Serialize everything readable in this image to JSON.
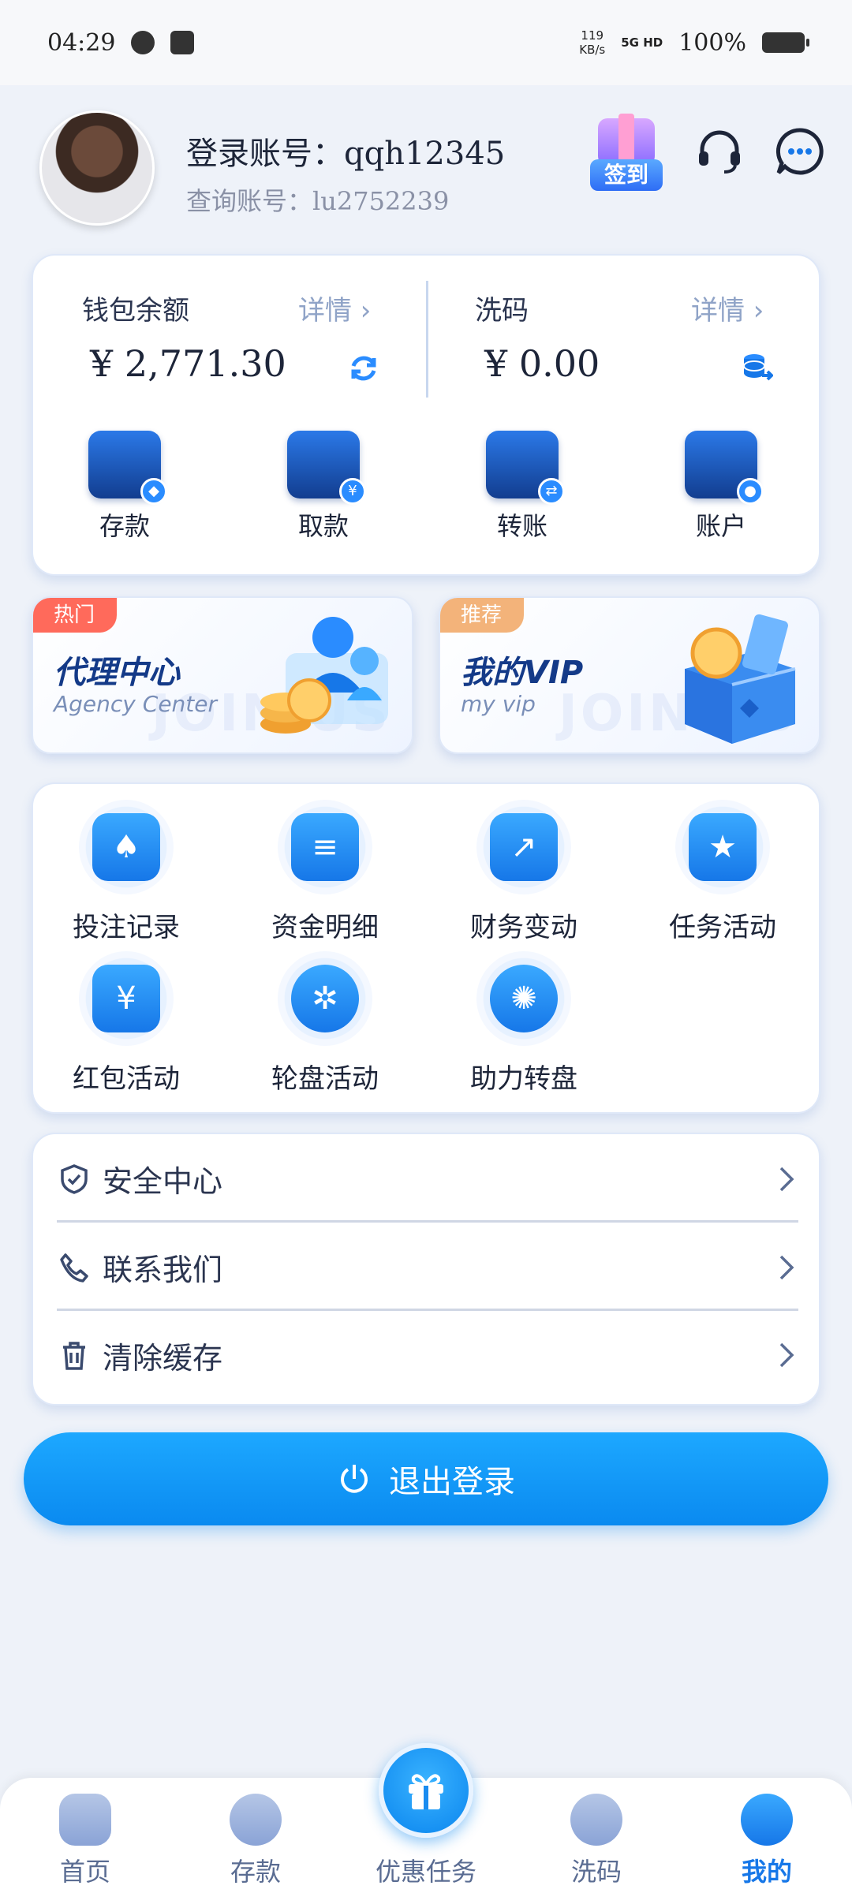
{
  "status_bar": {
    "time": "04:29",
    "net_speed": "119",
    "net_unit": "KB/s",
    "signal": "5G HD",
    "battery": "100%"
  },
  "header": {
    "login_account": "登录账号：qqh12345",
    "query_account": "查询账号：lu2752239",
    "checkin_label": "签到"
  },
  "wallet": {
    "balance_title": "钱包余额",
    "balance_detail": "详情 ›",
    "balance_amount": "¥ 2,771.30",
    "wash_title": "洗码",
    "wash_detail": "详情 ›",
    "wash_amount": "¥ 0.00",
    "actions": [
      {
        "label": "存款",
        "icon": "wallet-icon",
        "badge": "◆"
      },
      {
        "label": "取款",
        "icon": "card-icon",
        "badge": "¥"
      },
      {
        "label": "转账",
        "icon": "transfer-icon",
        "badge": "⇄"
      },
      {
        "label": "账户",
        "icon": "account-icon",
        "badge": "●"
      }
    ]
  },
  "promos": [
    {
      "tag": "热门",
      "title": "代理中心",
      "subtitle": "Agency Center",
      "watermark": "JOIN US",
      "tag_color": "#ff6a5b"
    },
    {
      "tag": "推荐",
      "title": "我的VIP",
      "subtitle": "my vip",
      "watermark": "JOIN US",
      "tag_color": "#f3b37a"
    }
  ],
  "grid": [
    {
      "label": "投注记录",
      "icon": "bet-record-icon"
    },
    {
      "label": "资金明细",
      "icon": "fund-detail-icon"
    },
    {
      "label": "财务变动",
      "icon": "finance-change-icon"
    },
    {
      "label": "任务活动",
      "icon": "task-activity-icon"
    },
    {
      "label": "红包活动",
      "icon": "red-packet-icon"
    },
    {
      "label": "轮盘活动",
      "icon": "roulette-icon"
    },
    {
      "label": "助力转盘",
      "icon": "boost-wheel-icon"
    }
  ],
  "menu": [
    {
      "label": "安全中心",
      "icon": "shield-icon"
    },
    {
      "label": "联系我们",
      "icon": "phone-icon"
    },
    {
      "label": "清除缓存",
      "icon": "trash-icon"
    }
  ],
  "logout_label": "退出登录",
  "nav": [
    {
      "label": "首页",
      "icon": "home-icon"
    },
    {
      "label": "存款",
      "icon": "deposit-icon"
    },
    {
      "label": "优惠任务",
      "icon": "gift-icon"
    },
    {
      "label": "洗码",
      "icon": "wash-icon"
    },
    {
      "label": "我的",
      "icon": "profile-icon"
    }
  ],
  "colors": {
    "accent": "#1677e8",
    "primary_button": "#0a8af0",
    "background": "#eef2f9"
  }
}
